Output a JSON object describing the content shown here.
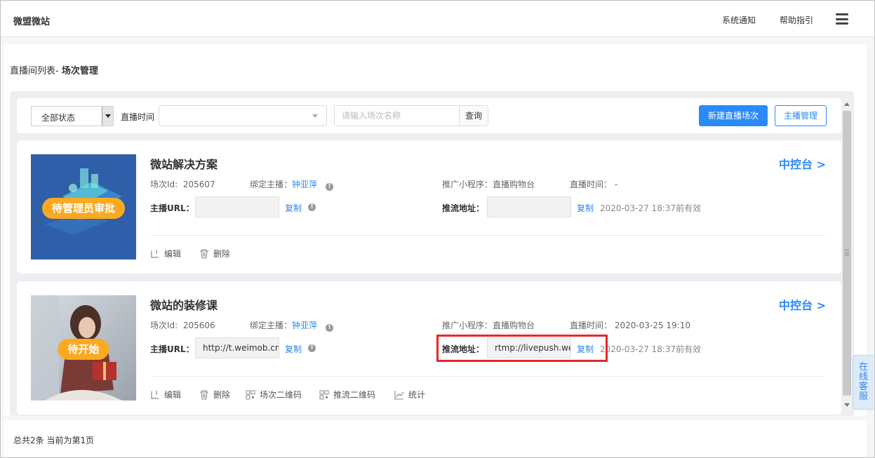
{
  "header": {
    "brand": "微盟微站",
    "links": [
      "系统通知",
      "帮助指引"
    ],
    "menu_icon": "hamburger-icon"
  },
  "breadcrumb": {
    "prefix": "直播间列表-",
    "current": "场次管理"
  },
  "filters": {
    "status_value": "全部状态",
    "time_label": "直播时间",
    "time_value": "",
    "search_placeholder": "请输入场次名称",
    "search_button": "查询",
    "new_button": "新建直播场次",
    "host_button": "主播管理"
  },
  "labels": {
    "id": "场次Id:",
    "host": "绑定主播：",
    "mini": "推广小程序：",
    "time": "直播时间：",
    "host_url": "主播URL：",
    "push_url": "推流地址：",
    "copy": "复制",
    "console": "中控台 >"
  },
  "sessions": [
    {
      "title": "微站解决方案",
      "status_badge": "待管理员审批",
      "id": "205607",
      "host": "钟亚萍",
      "mini_program": "直播购物台",
      "live_time": "-",
      "host_url": "",
      "push_url": "",
      "valid": "2020-03-27 18:37前有效",
      "actions": [
        "编辑",
        "删除"
      ]
    },
    {
      "title": "微站的装修课",
      "status_badge": "待开始",
      "id": "205606",
      "host": "钟亚萍",
      "mini_program": "直播购物台",
      "live_time": "2020-03-25 19:10",
      "host_url": "http://t.weimob.cn",
      "push_url": "rtmp://livepush.weimob.com",
      "valid": "2020-03-27 18:37前有效",
      "actions": [
        "编辑",
        "删除",
        "场次二维码",
        "推流二维码",
        "统计"
      ]
    }
  ],
  "footer": {
    "summary": "总共2条 当前为第1页"
  },
  "service": {
    "label": "在线客服"
  },
  "colors": {
    "primary": "#2b8af7",
    "badge": "#fba921",
    "highlight": "#e8262b"
  }
}
